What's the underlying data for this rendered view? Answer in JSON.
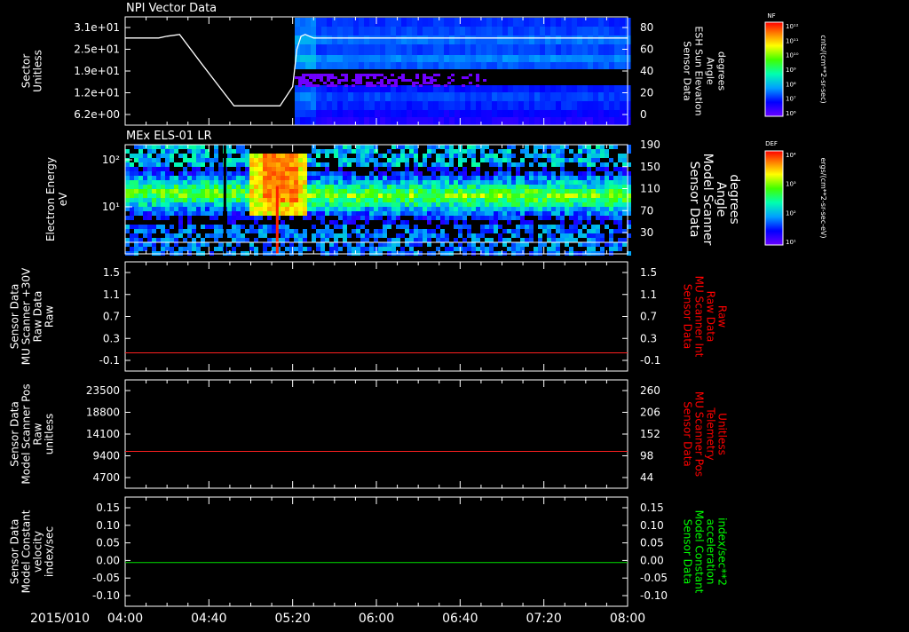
{
  "chart_data": [
    {
      "type": "heatmap",
      "title": "NPI Vector Data",
      "ylabel_left": [
        "Sector",
        "Unitless"
      ],
      "yticks_left": [
        "3.1e+01",
        "2.5e+01",
        "1.9e+01",
        "1.2e+01",
        "6.2e+00"
      ],
      "ylabel_right": [
        "Sensor Data",
        "ESH Sun Elevation",
        "Angle",
        "degrees"
      ],
      "yticks_right": [
        "80",
        "60",
        "40",
        "20",
        "0"
      ],
      "ylim_right": [
        -20,
        80
      ],
      "series": [
        {
          "name": "Sensor Data ESH Sun Elevation Angle",
          "x": [
            "04:00",
            "04:16",
            "04:20",
            "04:26",
            "04:36",
            "04:52",
            "05:08",
            "05:14",
            "05:20",
            "05:22",
            "05:24",
            "05:26",
            "05:30",
            "08:00"
          ],
          "values": [
            68,
            68,
            70,
            72,
            40,
            -10,
            -10,
            -10,
            12,
            55,
            70,
            72,
            68,
            68
          ]
        }
      ],
      "heatmap_note": "data present from 05:21 to 08:00"
    },
    {
      "type": "heatmap",
      "title": "MEx ELS-01 LR",
      "ylabel_left": [
        "Electron Energy",
        "eV"
      ],
      "yticks_left": [
        "10²",
        "10¹"
      ],
      "ylabel_right": [
        "Sensor Data",
        "Model Scanner",
        "Angle",
        "degrees"
      ],
      "yticks_right": [
        "190",
        "150",
        "110",
        "70",
        "30"
      ],
      "ylim_right": [
        10,
        190
      ]
    },
    {
      "type": "line",
      "ylabel_left": [
        "Sensor Data",
        "MU Scanner +30V",
        "Raw Data",
        "Raw"
      ],
      "yticks_left": [
        "1.5",
        "1.1",
        "0.7",
        "0.3",
        "-0.1"
      ],
      "ylabel_right": [
        "Sensor Data",
        "MU Scanner Int",
        "Raw Data",
        "Raw"
      ],
      "yticks_right": [
        "1.5",
        "1.1",
        "0.7",
        "0.3",
        "-0.1"
      ],
      "ylim": [
        -0.3,
        1.5
      ],
      "series": [
        {
          "name": "Sensor Data MU Scanner Int Raw Data",
          "x": [
            "04:00",
            "08:00"
          ],
          "values": [
            0.0,
            0.0
          ]
        }
      ]
    },
    {
      "type": "line",
      "ylabel_left": [
        "Sensor Data",
        "Model Scanner Pos",
        "Raw",
        "unitless"
      ],
      "yticks_left": [
        "23500",
        "18800",
        "14100",
        "9400",
        "4700"
      ],
      "ylabel_right": [
        "Sensor Data",
        "MU Scanner Pos",
        "Telemetry",
        "Unitless"
      ],
      "yticks_right": [
        "260",
        "206",
        "152",
        "98",
        "44"
      ],
      "ylim": [
        0,
        23500
      ],
      "series": [
        {
          "name": "Sensor Data MU Scanner Pos Telemetry",
          "x": [
            "04:00",
            "08:00"
          ],
          "values": [
            8000,
            8000
          ]
        }
      ]
    },
    {
      "type": "line",
      "ylabel_left": [
        "Sensor Data",
        "Model Constant",
        "velocity",
        "index/sec"
      ],
      "yticks_left": [
        "0.15",
        "0.10",
        "0.05",
        "0.00",
        "-0.05",
        "-0.10"
      ],
      "ylabel_right": [
        "Sensor Data",
        "Model Constant",
        "acceleration",
        "index/sec**2"
      ],
      "yticks_right": [
        "0.15",
        "0.10",
        "0.05",
        "0.00",
        "-0.05",
        "-0.10"
      ],
      "ylim": [
        -0.1,
        0.15
      ],
      "series": [
        {
          "name": "Sensor Data Model Constant acceleration",
          "x": [
            "04:00",
            "08:00"
          ],
          "values": [
            0.0,
            0.0
          ]
        }
      ]
    }
  ],
  "xaxis": {
    "date": "2015/010",
    "ticks": [
      "04:00",
      "04:40",
      "05:20",
      "06:00",
      "06:40",
      "07:20",
      "08:00"
    ]
  },
  "colorbars": [
    {
      "label": "NF",
      "unit": "cnts/(cm**2-sr-sec)",
      "ticks": [
        "10¹²",
        "10¹¹",
        "10¹⁰",
        "10⁹",
        "10⁸",
        "10⁷",
        "10⁶"
      ]
    },
    {
      "label": "DEF",
      "unit": "ergs/(cm**2-sr-sec-eV)",
      "ticks": [
        "10⁴",
        "10³",
        "10²",
        "10¹"
      ]
    }
  ],
  "colors": {
    "red_label": "#ff0000",
    "green_label": "#00ff00",
    "red_line": "#ff2020",
    "green_line": "#00e000"
  }
}
